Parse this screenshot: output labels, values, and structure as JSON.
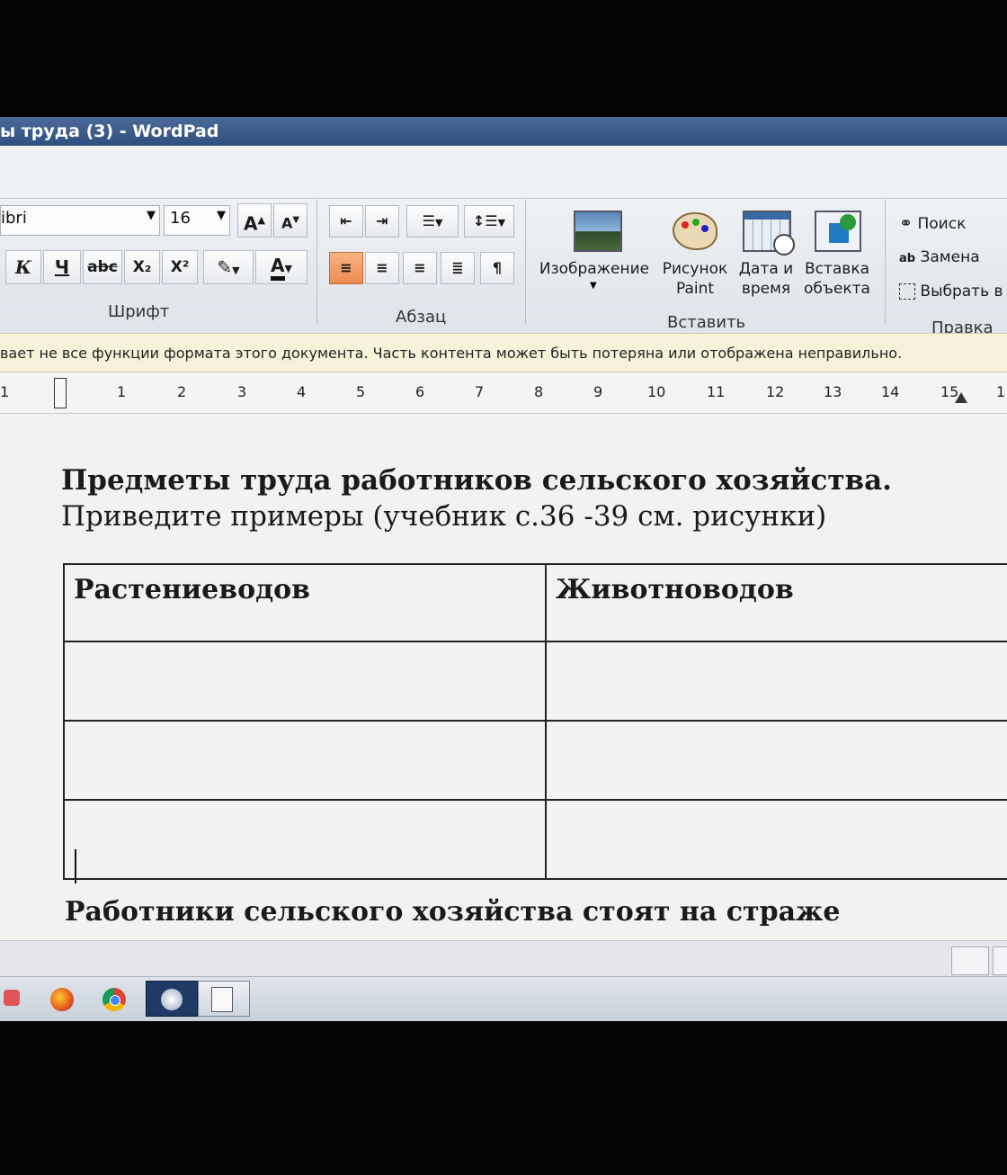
{
  "window": {
    "title": "ы труда (3) - WordPad"
  },
  "ribbon": {
    "font": {
      "name": "ibri",
      "size": "16",
      "grow": "A",
      "shrink": "A",
      "bold": "К",
      "underline": "Ч",
      "strike": "abc",
      "subscript": "X₂",
      "superscript": "X²",
      "color_letter": "A",
      "group_label": "Шрифт"
    },
    "paragraph": {
      "group_label": "Абзац"
    },
    "insert": {
      "image_label": "Изображение",
      "paint_label": "Рисунок Paint",
      "datetime_label": "Дата и время",
      "object_label": "Вставка объекта",
      "group_label": "Вставить"
    },
    "edit": {
      "find_label": "Поиск",
      "replace_label": "Замена",
      "select_label": "Выбрать в",
      "group_label": "Правка"
    }
  },
  "infobar": {
    "text": "вает не все функции формата этого документа. Часть контента может быть потеряна или отображена неправильно."
  },
  "ruler": {
    "numbers": [
      "1",
      "1",
      "2",
      "3",
      "4",
      "5",
      "6",
      "7",
      "8",
      "9",
      "10",
      "11",
      "12",
      "13",
      "14",
      "15",
      "1"
    ]
  },
  "document": {
    "title": "Предметы труда работников сельского хозяйства.",
    "subtitle": "Приведите примеры (учебник с.36 -39 см. рисунки)",
    "table": {
      "headers": [
        "Растениеводов",
        "Животноводов"
      ]
    },
    "bottom_text": "Работники сельского хозяйства стоят на страже"
  },
  "colors": {
    "titlebar": "#3b5b8c",
    "selected_button": "#ec8a4f",
    "infobar": "#f7f3da"
  }
}
